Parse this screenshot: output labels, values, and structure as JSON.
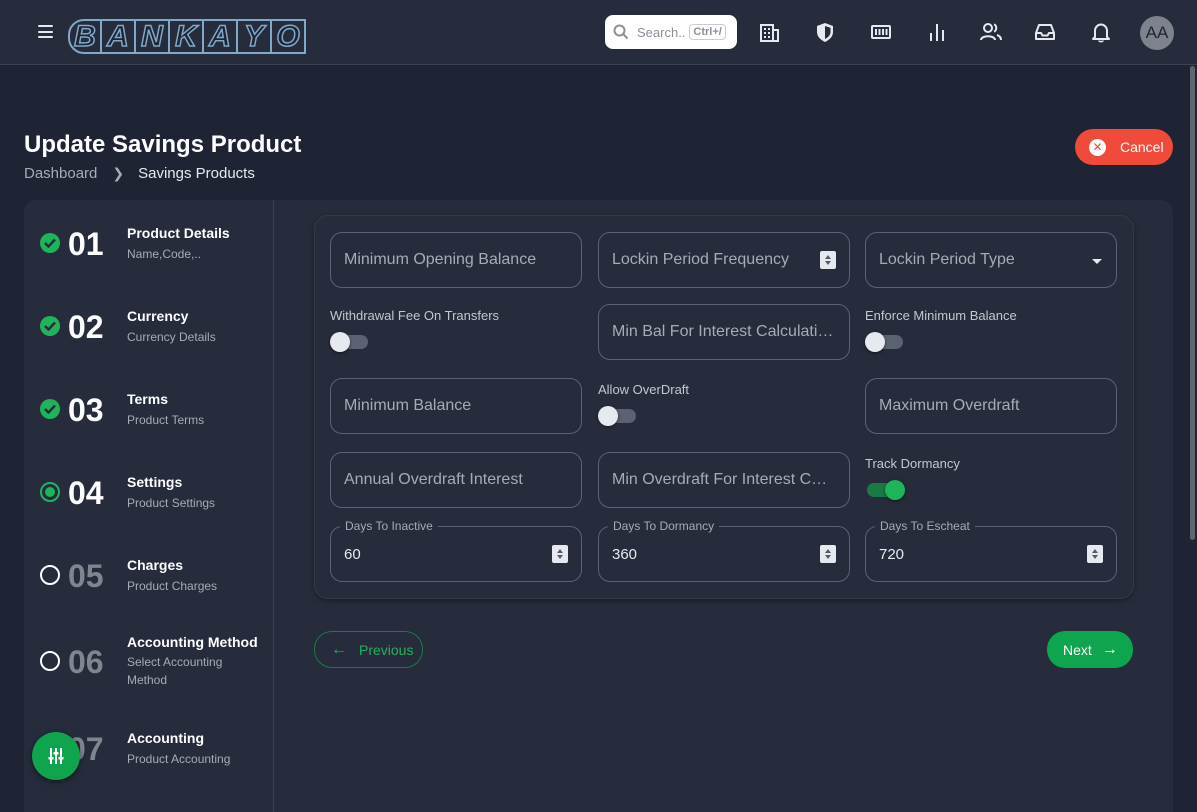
{
  "app": {
    "logo_letters": [
      "B",
      "A",
      "N",
      "K",
      "A",
      "Y",
      "O"
    ]
  },
  "topbar": {
    "search_placeholder": "Search..",
    "search_shortcut": "Ctrl+/",
    "avatar_initials": "AA"
  },
  "header": {
    "title": "Update Savings Product",
    "breadcrumb": [
      "Dashboard",
      "Savings Products"
    ],
    "cancel_label": "Cancel"
  },
  "steps": [
    {
      "num": "01",
      "title": "Product Details",
      "sub": "Name,Code,..",
      "status": "done"
    },
    {
      "num": "02",
      "title": "Currency",
      "sub": "Currency Details",
      "status": "done"
    },
    {
      "num": "03",
      "title": "Terms",
      "sub": "Product Terms",
      "status": "done"
    },
    {
      "num": "04",
      "title": "Settings",
      "sub": "Product Settings",
      "status": "current"
    },
    {
      "num": "05",
      "title": "Charges",
      "sub": "Product Charges",
      "status": "todo"
    },
    {
      "num": "06",
      "title": "Accounting Method",
      "sub": "Select Accounting Method",
      "status": "todo"
    },
    {
      "num": "07",
      "title": "Accounting",
      "sub": "Product Accounting",
      "status": "todo"
    }
  ],
  "form": {
    "min_opening_balance": "Minimum Opening Balance",
    "lockin_period_frequency": "Lockin Period Frequency",
    "lockin_period_type": "Lockin Period Type",
    "withdrawal_fee_label": "Withdrawal Fee On Transfers",
    "withdrawal_fee_on": false,
    "min_bal_interest_calc": "Min Bal For Interest Calculation",
    "enforce_min_balance_label": "Enforce Minimum Balance",
    "enforce_min_balance_on": false,
    "minimum_balance": "Minimum Balance",
    "allow_overdraft_label": "Allow OverDraft",
    "allow_overdraft_on": false,
    "maximum_overdraft": "Maximum Overdraft",
    "annual_overdraft_interest": "Annual Overdraft Interest",
    "min_overdraft_interest_calc": "Min Overdraft For Interest Calculation",
    "track_dormancy_label": "Track Dormancy",
    "track_dormancy_on": true,
    "days_to_inactive_label": "Days To Inactive",
    "days_to_inactive": "60",
    "days_to_dormancy_label": "Days To Dormancy",
    "days_to_dormancy": "360",
    "days_to_escheat_label": "Days To Escheat",
    "days_to_escheat": "720"
  },
  "nav": {
    "previous_label": "Previous",
    "next_label": "Next"
  },
  "colors": {
    "accent_green": "#1fb35b",
    "cancel_red": "#f04a3a",
    "background": "#1e2433",
    "surface": "#262c3b"
  }
}
